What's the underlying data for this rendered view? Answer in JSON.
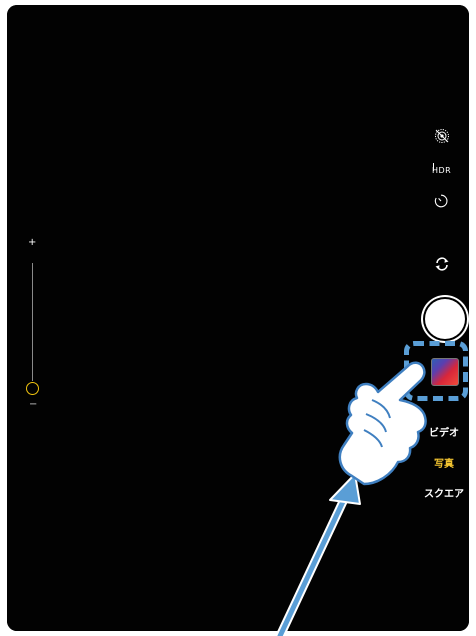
{
  "camera": {
    "zoom": {
      "plus_label": "+",
      "minus_label": "−",
      "level": 0.0
    },
    "controls": {
      "live_photo_icon": "live-photo-off-icon",
      "hdr_label": "HDR",
      "timer_icon": "timer-icon",
      "switch_camera_icon": "switch-camera-icon"
    },
    "shutter_icon": "shutter-button",
    "thumbnail_icon": "photo-library-thumbnail",
    "modes": [
      {
        "label": "ビデオ",
        "selected": false
      },
      {
        "label": "写真",
        "selected": true
      },
      {
        "label": "スクエア",
        "selected": false
      }
    ]
  },
  "overlay": {
    "highlight_color": "#5a9ed6",
    "hand_icon": "tap-hand-icon",
    "arrow_icon": "pointer-arrow-icon"
  },
  "colors": {
    "accent_yellow": "#f4c531",
    "background": "#000000"
  }
}
